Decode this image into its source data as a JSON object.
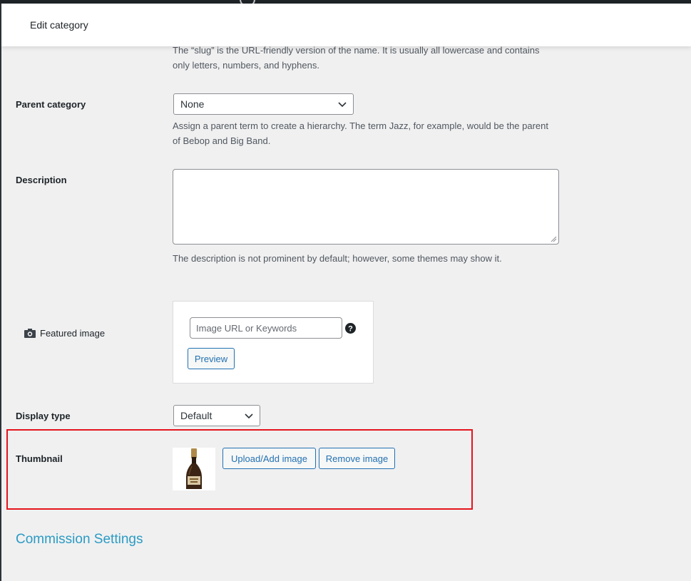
{
  "header": {
    "title": "Edit category"
  },
  "slug": {
    "description": "The “slug” is the URL-friendly version of the name. It is usually all lowercase and contains only letters, numbers, and hyphens."
  },
  "parent": {
    "label": "Parent category",
    "value": "None",
    "description": "Assign a parent term to create a hierarchy. The term Jazz, for example, would be the parent of Bebop and Big Band."
  },
  "description_field": {
    "label": "Description",
    "value": "",
    "description": "The description is not prominent by default; however, some themes may show it."
  },
  "featured_image": {
    "label": "Featured image",
    "icon": "camera-icon",
    "placeholder": "Image URL or Keywords",
    "help_icon": "question-circle-icon",
    "preview_label": "Preview"
  },
  "display_type": {
    "label": "Display type",
    "value": "Default"
  },
  "thumbnail": {
    "label": "Thumbnail",
    "upload_label": "Upload/Add image",
    "remove_label": "Remove image",
    "highlight_color": "#e5141b"
  },
  "commission": {
    "title": "Commission Settings"
  },
  "colors": {
    "accent": "#2271b1",
    "link_heading": "#2b9bc3",
    "background": "#f0f0f1"
  }
}
